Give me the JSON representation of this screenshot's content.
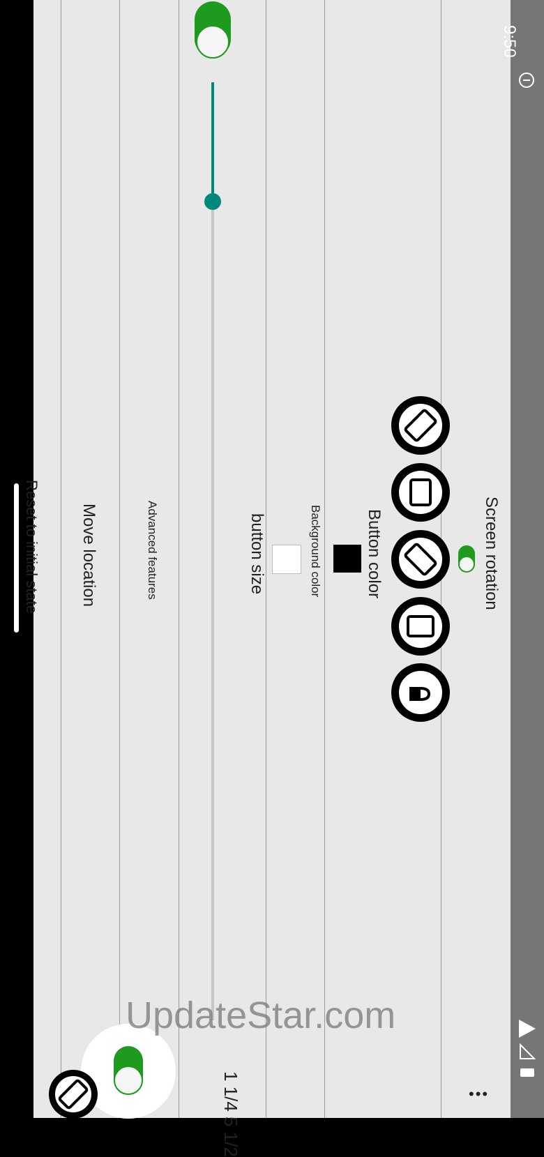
{
  "status_bar": {
    "time": "9:50"
  },
  "section_screen_rotation": {
    "title": "Screen rotation"
  },
  "rotation_buttons": [
    {
      "name": "auto-rotate-icon"
    },
    {
      "name": "landscape-icon"
    },
    {
      "name": "rotate-diagonal-icon"
    },
    {
      "name": "portrait-icon"
    },
    {
      "name": "rotation-lock-icon"
    }
  ],
  "button_color": {
    "label": "Button color",
    "color": "#000000"
  },
  "background_color": {
    "label": "Background color",
    "color": "#ffffff"
  },
  "button_size": {
    "label": "button size",
    "value": 12,
    "max": 100
  },
  "advanced_features": {
    "label": "Advanced features"
  },
  "move_location": {
    "label": "Move location"
  },
  "reset": {
    "label": "Reset to initial state"
  },
  "watermark": {
    "text": "UpdateStar.com"
  },
  "floating_value": {
    "text": "1 1/4 5 1/2"
  },
  "colors": {
    "toggle_on": "#1e9a1e",
    "slider": "#00897b",
    "status_bar": "#767676"
  }
}
